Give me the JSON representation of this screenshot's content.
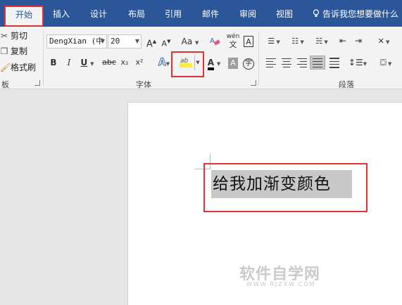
{
  "tabs": [
    {
      "label": "开始",
      "active": true
    },
    {
      "label": "插入"
    },
    {
      "label": "设计"
    },
    {
      "label": "布局"
    },
    {
      "label": "引用"
    },
    {
      "label": "邮件"
    },
    {
      "label": "审阅"
    },
    {
      "label": "视图"
    }
  ],
  "tell_me": "告诉我您想要做什么",
  "clipboard": {
    "cut": "剪切",
    "copy": "复制",
    "format_painter": "格式刷",
    "group_label": "板"
  },
  "font": {
    "name": "DengXian (中",
    "size": "20",
    "group_label": "字体",
    "grow": "A",
    "shrink": "A",
    "change_case": "Aa",
    "phonetic": "wén",
    "bold": "B",
    "italic": "I",
    "underline": "U",
    "strike": "abc",
    "subscript": "x₂",
    "superscript": "x²",
    "highlight_text": "ab",
    "highlight_color": "#ffeb3b",
    "font_color_letter": "A",
    "font_color": "#000000",
    "shading": "A",
    "enclose": "字"
  },
  "paragraph": {
    "group_label": "段落"
  },
  "document": {
    "text": "给我加渐变颜色"
  },
  "watermark": {
    "main": "软件自学网",
    "sub": "WWW.RJZXW.COM"
  }
}
